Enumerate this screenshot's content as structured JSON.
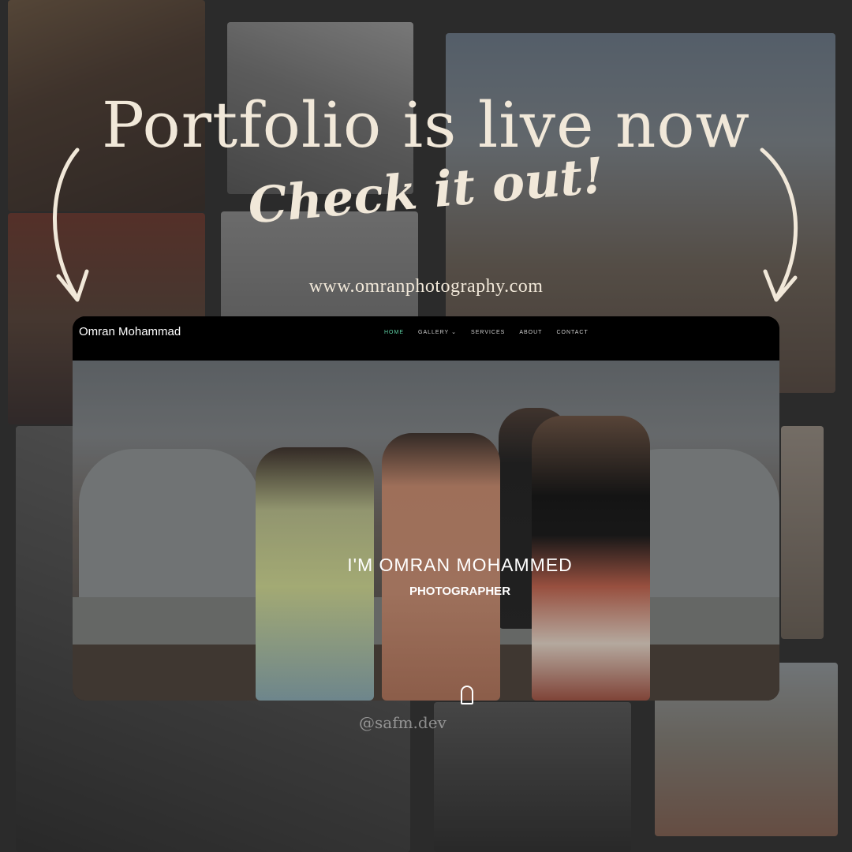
{
  "promo": {
    "headline": "Portfolio is live now",
    "subhead": "Check it out!",
    "url": "www.omranphotography.com",
    "watermark": "@safm.dev",
    "text_color": "#f1e8d9"
  },
  "site": {
    "brand": "Omran Mohammad",
    "nav": [
      {
        "label": "HOME",
        "active": true
      },
      {
        "label": "GALLERY",
        "has_dropdown": true
      },
      {
        "label": "SERVICES"
      },
      {
        "label": "ABOUT"
      },
      {
        "label": "CONTACT"
      }
    ],
    "hero": {
      "title": "I'M OMRAN MOHAMMED",
      "subtitle": "PHOTOGRAPHER"
    },
    "accent_color": "#5fd2a6"
  },
  "icons": {
    "dropdown": "chevron-down-icon",
    "arrows": "curved-arrow-icon",
    "scroll": "scroll-mouse-icon"
  }
}
